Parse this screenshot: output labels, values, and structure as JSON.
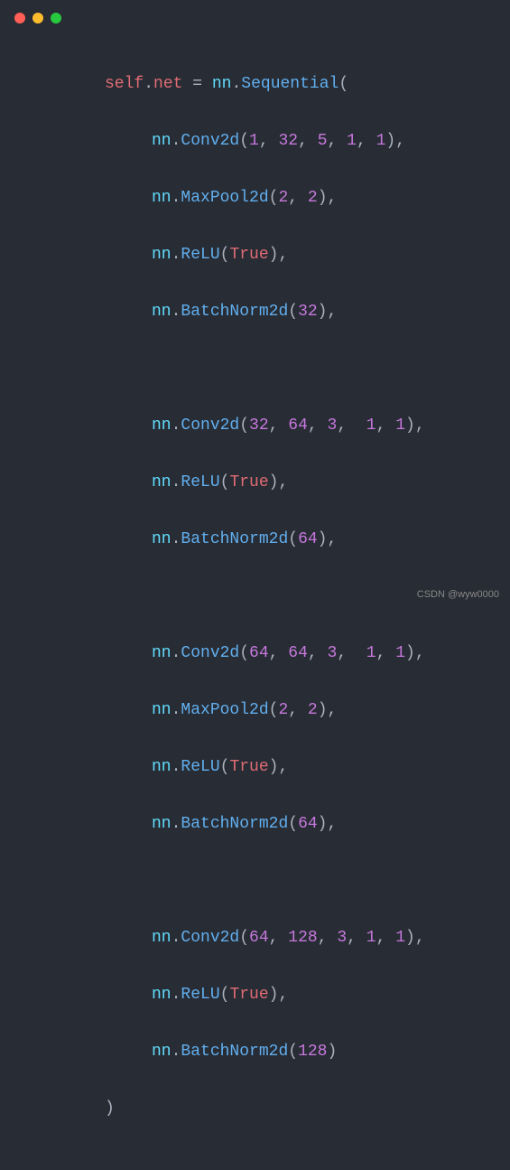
{
  "titlebar": {
    "dots": [
      "red",
      "yellow",
      "green"
    ]
  },
  "code": {
    "self": "self",
    "attr_net": "net",
    "eq": "=",
    "nn": "nn",
    "Sequential": "Sequential",
    "Conv2d": "Conv2d",
    "MaxPool2d": "MaxPool2d",
    "ReLU": "ReLU",
    "BatchNorm2d": "BatchNorm2d",
    "True": "True",
    "dot": ".",
    "comma": ",",
    "lparen": "(",
    "rparen": ")",
    "n1": "1",
    "n2": "2",
    "n3": "3",
    "n5": "5",
    "n32": "32",
    "n64": "64",
    "n128": "128"
  },
  "watermark": "CSDN @wyw0000"
}
